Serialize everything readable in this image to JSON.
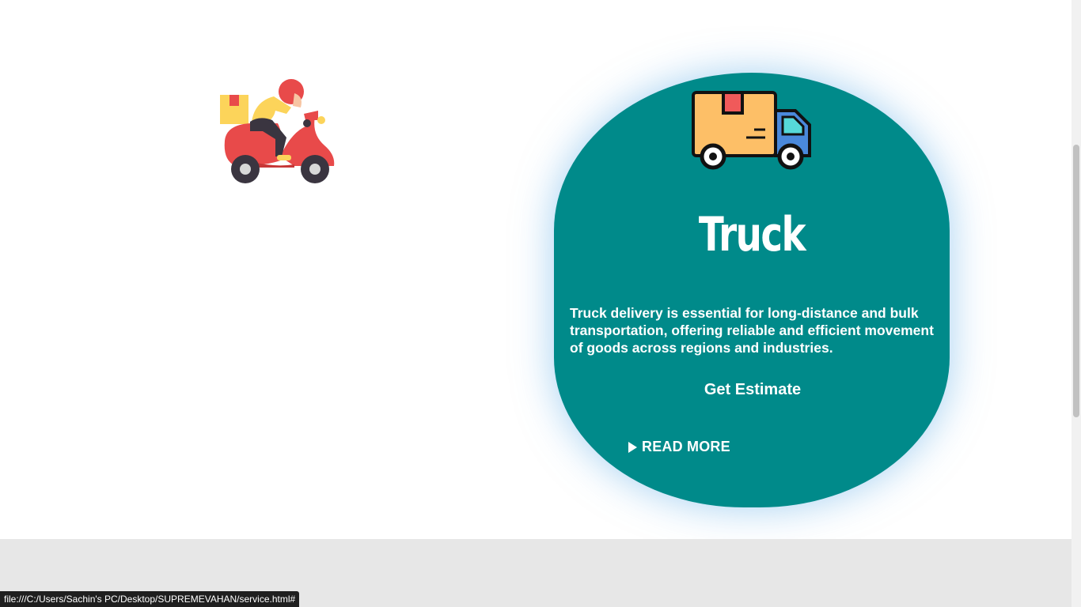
{
  "service": {
    "title": "Truck",
    "description": "Truck delivery is essential for long-distance and bulk transportation, offering reliable and efficient movement of goods across regions and industries.",
    "estimate_label": "Get Estimate",
    "read_more_label": "READ MORE",
    "truck_icon": "truck-icon",
    "scooter_icon": "delivery-scooter-icon",
    "card_color": "#008a8a"
  },
  "status_bar": {
    "url": "file:///C:/Users/Sachin's PC/Desktop/SUPREMEVAHAN/service.html#"
  }
}
